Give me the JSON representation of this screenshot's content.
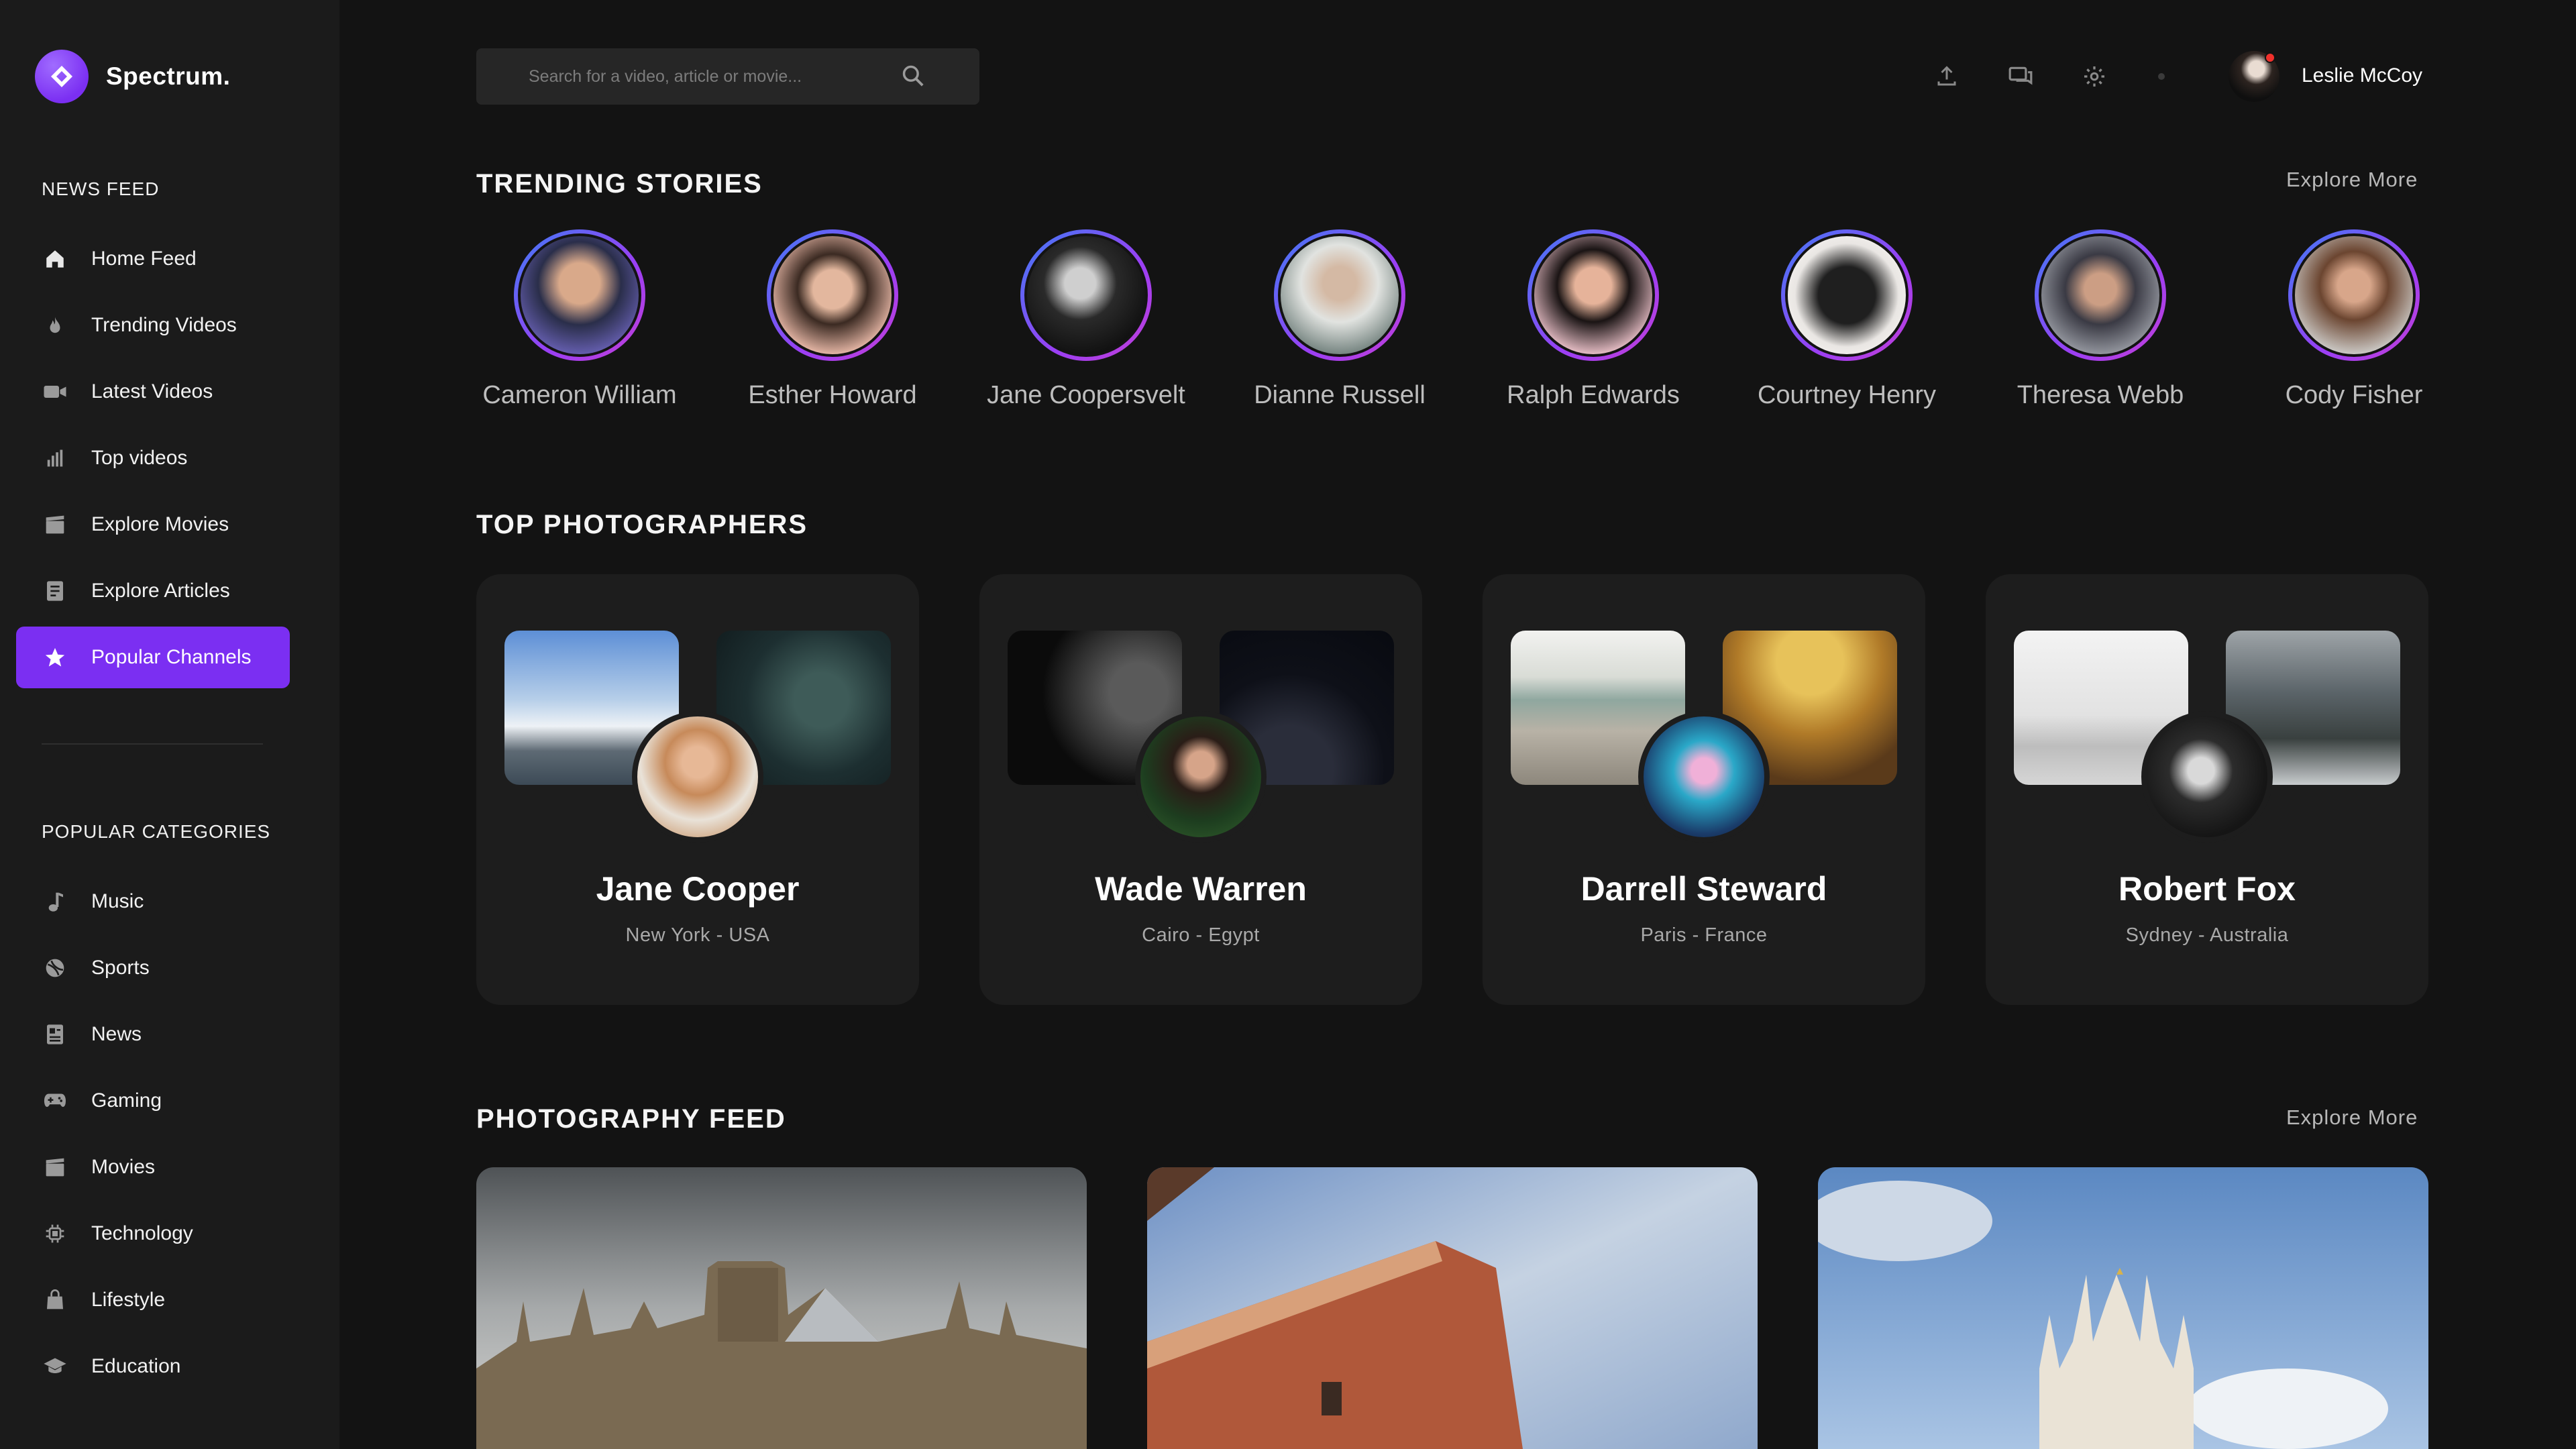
{
  "brand": {
    "name": "Spectrum."
  },
  "sidebar": {
    "news_feed_label": "NEWS FEED",
    "nav": [
      {
        "label": "Home Feed",
        "icon": "home-icon"
      },
      {
        "label": "Trending Videos",
        "icon": "fire-icon"
      },
      {
        "label": "Latest Videos",
        "icon": "video-camera-icon"
      },
      {
        "label": "Top videos",
        "icon": "bar-chart-icon"
      },
      {
        "label": "Explore Movies",
        "icon": "clapperboard-icon"
      },
      {
        "label": "Explore Articles",
        "icon": "article-icon"
      },
      {
        "label": "Popular Channels",
        "icon": "star-icon",
        "active": true
      }
    ],
    "categories_label": "POPULAR CATEGORIES",
    "categories": [
      {
        "label": "Music",
        "icon": "music-note-icon"
      },
      {
        "label": "Sports",
        "icon": "ball-icon"
      },
      {
        "label": "News",
        "icon": "newspaper-icon"
      },
      {
        "label": "Gaming",
        "icon": "gamepad-icon"
      },
      {
        "label": "Movies",
        "icon": "clapperboard-icon"
      },
      {
        "label": "Technology",
        "icon": "chip-icon"
      },
      {
        "label": "Lifestyle",
        "icon": "bag-icon"
      },
      {
        "label": "Education",
        "icon": "graduation-cap-icon"
      }
    ]
  },
  "search": {
    "placeholder": "Search for a video, article or movie..."
  },
  "topbar": {
    "username": "Leslie McCoy"
  },
  "trending": {
    "title": "TRENDING STORIES",
    "explore": "Explore More",
    "stories": [
      {
        "name": "Cameron William"
      },
      {
        "name": "Esther Howard"
      },
      {
        "name": "Jane Coopersvelt"
      },
      {
        "name": "Dianne Russell"
      },
      {
        "name": "Ralph Edwards"
      },
      {
        "name": "Courtney Henry"
      },
      {
        "name": "Theresa Webb"
      },
      {
        "name": "Cody Fisher"
      }
    ]
  },
  "photographers": {
    "title": "TOP PHOTOGRAPHERS",
    "cards": [
      {
        "name": "Jane Cooper",
        "location": "New York - USA"
      },
      {
        "name": "Wade Warren",
        "location": "Cairo - Egypt"
      },
      {
        "name": "Darrell Steward",
        "location": "Paris - France"
      },
      {
        "name": "Robert Fox",
        "location": "Sydney - Australia"
      }
    ]
  },
  "feed": {
    "title": "PHOTOGRAPHY FEED",
    "explore": "Explore More"
  },
  "colors": {
    "accent": "#7b2ff2",
    "background": "#131313",
    "sidebar": "#1b1b1b",
    "card": "#1d1d1d"
  }
}
